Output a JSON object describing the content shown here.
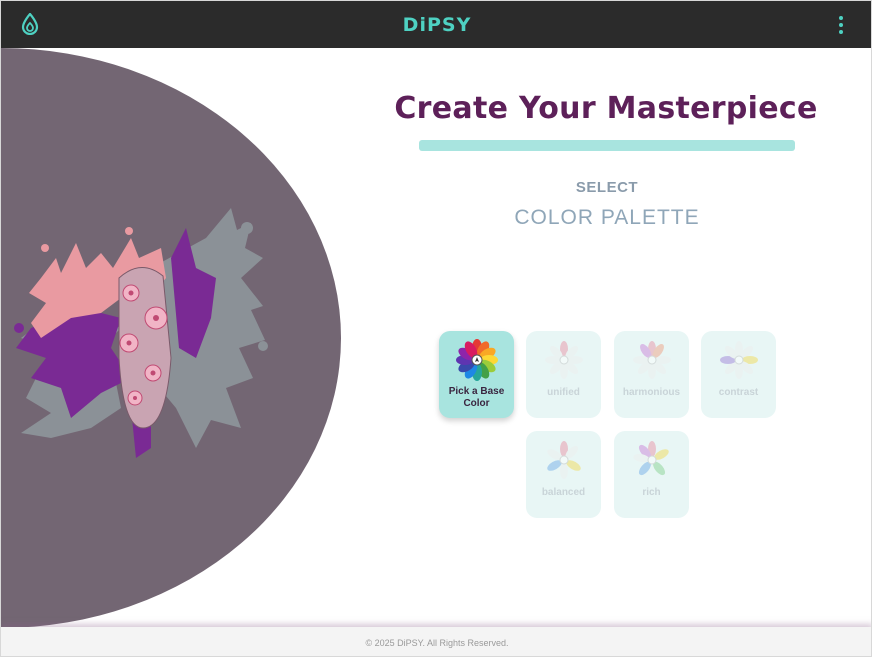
{
  "header": {
    "brand": "DiPSY",
    "logo_icon": "droplet-logo-icon",
    "menu_icon": "kebab-menu-icon",
    "accent_color": "#4ed1c2",
    "background_color": "#2b2b2b"
  },
  "hero": {
    "image": "nail-paint-splash-illustration",
    "background_color": "#736673"
  },
  "main": {
    "title": "Create Your Masterpiece",
    "title_color": "#5d2059",
    "underline_color": "#a8e4df",
    "select_label": "SELECT",
    "palette_label": "COLOR PALETTE"
  },
  "palette_options": [
    {
      "id": "base",
      "label": "Pick a Base Color",
      "state": "active",
      "icon": "color-wheel-icon"
    },
    {
      "id": "unified",
      "label": "unified",
      "state": "disabled",
      "icon": "unified-wheel-icon"
    },
    {
      "id": "harmonious",
      "label": "harmonious",
      "state": "disabled",
      "icon": "harmonious-wheel-icon"
    },
    {
      "id": "contrast",
      "label": "contrast",
      "state": "disabled",
      "icon": "contrast-wheel-icon"
    },
    {
      "id": "balanced",
      "label": "balanced",
      "state": "disabled",
      "icon": "balanced-wheel-icon"
    },
    {
      "id": "rich",
      "label": "rich",
      "state": "disabled",
      "icon": "rich-wheel-icon"
    }
  ],
  "footer": {
    "copyright": "© 2025 DiPSY. All Rights Reserved."
  }
}
